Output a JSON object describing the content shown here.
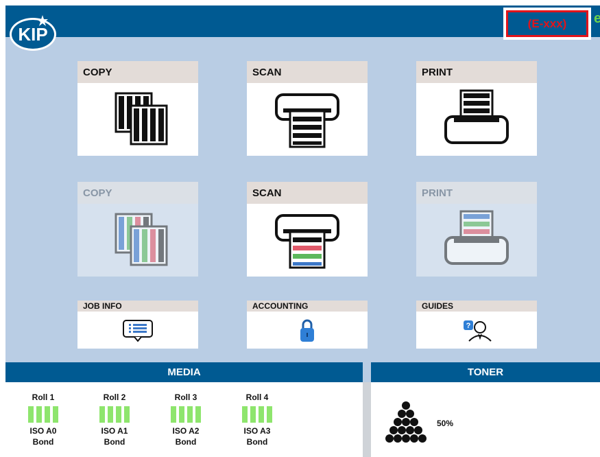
{
  "header": {
    "logo_text": "KIP",
    "error_code": "(E-xxx)"
  },
  "tiles": {
    "copy_bw": {
      "label": "COPY"
    },
    "scan_bw": {
      "label": "SCAN"
    },
    "print_bw": {
      "label": "PRINT"
    },
    "copy_color": {
      "label": "COPY"
    },
    "scan_color": {
      "label": "SCAN"
    },
    "print_color": {
      "label": "PRINT"
    }
  },
  "shortcuts": {
    "job_info": {
      "label": "JOB INFO"
    },
    "accounting": {
      "label": "ACCOUNTING"
    },
    "guides": {
      "label": "GUIDES"
    }
  },
  "media": {
    "title": "MEDIA",
    "rolls": [
      {
        "name": "Roll 1",
        "size": "ISO A0",
        "type": "Bond"
      },
      {
        "name": "Roll 2",
        "size": "ISO A1",
        "type": "Bond"
      },
      {
        "name": "Roll 3",
        "size": "ISO A2",
        "type": "Bond"
      },
      {
        "name": "Roll 4",
        "size": "ISO A3",
        "type": "Bond"
      }
    ]
  },
  "toner": {
    "title": "TONER",
    "level": "50%"
  },
  "colors": {
    "brand_blue": "#005a92",
    "background": "#b9cde4",
    "error_red": "#e1141b",
    "media_green": "#8ee56d"
  }
}
